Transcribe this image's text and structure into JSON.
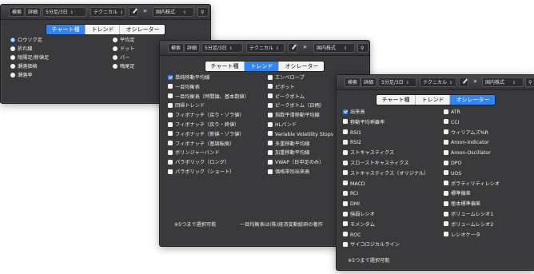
{
  "toolbar": {
    "search": "検索",
    "detail": "詳細",
    "period": "5分足/3日",
    "technical": "テクニカル",
    "more": "»",
    "market": "国内株式",
    "select_arrow": "⇕"
  },
  "tabs": {
    "chart_type": "チャート種",
    "trend": "トレンド",
    "oscillator": "オシレーター"
  },
  "panel_chart_type": {
    "items": [
      {
        "label": "ロウソク足",
        "selected": true
      },
      {
        "label": "平均足",
        "selected": false
      },
      {
        "label": "折れ線",
        "selected": false
      },
      {
        "label": "ドット",
        "selected": false
      },
      {
        "label": "陰陽足/新値足",
        "selected": false
      },
      {
        "label": "バー",
        "selected": false
      },
      {
        "label": "瀬落価格",
        "selected": false
      },
      {
        "label": "鳴尾足",
        "selected": false
      },
      {
        "label": "瀬落率",
        "selected": false
      }
    ]
  },
  "panel_trend": {
    "items": [
      {
        "label": "単純移動平均線",
        "checked": true
      },
      {
        "label": "エンベロープ",
        "checked": false
      },
      {
        "label": "一目均衡表",
        "checked": false
      },
      {
        "label": "ピボット",
        "checked": false
      },
      {
        "label": "一目均衡表（時間論、基本数値）",
        "checked": false
      },
      {
        "label": "ピークボトム",
        "checked": false
      },
      {
        "label": "回帰トレンド",
        "checked": false
      },
      {
        "label": "ピークボトム（日柄）",
        "checked": false
      },
      {
        "label": "フィボナッチ（戻り・ゾラ値）",
        "checked": false
      },
      {
        "label": "指数平滑移動平均線",
        "checked": false
      },
      {
        "label": "フィボナッチ（戻り・終値）",
        "checked": false
      },
      {
        "label": "HLバンド",
        "checked": false
      },
      {
        "label": "フィボナッチ（新値・ゾラ値）",
        "checked": false
      },
      {
        "label": "Variable Volatility Stops",
        "checked": false
      },
      {
        "label": "フィボナッチ（基調転換）",
        "checked": false
      },
      {
        "label": "多重移動平均線",
        "checked": false
      },
      {
        "label": "ボリンジャーバンド",
        "checked": false
      },
      {
        "label": "加重移動平均線",
        "checked": false
      },
      {
        "label": "パラボリック（ロング）",
        "checked": false
      },
      {
        "label": "VWAP（日中足のみ）",
        "checked": false
      },
      {
        "label": "パラボリック（ショート）",
        "checked": false
      },
      {
        "label": "価格帯別出来高",
        "checked": false
      }
    ],
    "note": "※5つまで選択可能",
    "note2": "一目均衡表は(株)経済変動総研の著作"
  },
  "panel_oscillator": {
    "items": [
      {
        "label": "出来高",
        "checked": true
      },
      {
        "label": "ATR",
        "checked": false
      },
      {
        "label": "移動平均乖離率",
        "checked": false
      },
      {
        "label": "CCI",
        "checked": false
      },
      {
        "label": "RSI1",
        "checked": false
      },
      {
        "label": "ウィリアムズ%R",
        "checked": false
      },
      {
        "label": "RSI2",
        "checked": false
      },
      {
        "label": "Aroon-Indicator",
        "checked": false
      },
      {
        "label": "ストキャスティクス",
        "checked": false
      },
      {
        "label": "Aroon-Oscillator",
        "checked": false
      },
      {
        "label": "スローストキャスティクス",
        "checked": false
      },
      {
        "label": "DPO",
        "checked": false
      },
      {
        "label": "ストキャスティクス（オリジナル）",
        "checked": false
      },
      {
        "label": "UOS",
        "checked": false
      },
      {
        "label": "MACD",
        "checked": false
      },
      {
        "label": "ボラティリティレシオ",
        "checked": false
      },
      {
        "label": "RCI",
        "checked": false
      },
      {
        "label": "標準偏差",
        "checked": false
      },
      {
        "label": "DMI",
        "checked": false
      },
      {
        "label": "極本標準偏差",
        "checked": false
      },
      {
        "label": "強弱レシオ",
        "checked": false
      },
      {
        "label": "ボリュームレシオ1",
        "checked": false
      },
      {
        "label": "モメンタム",
        "checked": false
      },
      {
        "label": "ボリュームレシオ2",
        "checked": false
      },
      {
        "label": "ROC",
        "checked": false
      },
      {
        "label": "レシオケータ",
        "checked": false
      },
      {
        "label": "サイコロジカルライン",
        "checked": false
      }
    ],
    "note": "※5つまで選択可能"
  },
  "colors": {
    "accent": "#2f86f6",
    "panel": "#3a3a3d",
    "text": "#f0f0f0"
  }
}
